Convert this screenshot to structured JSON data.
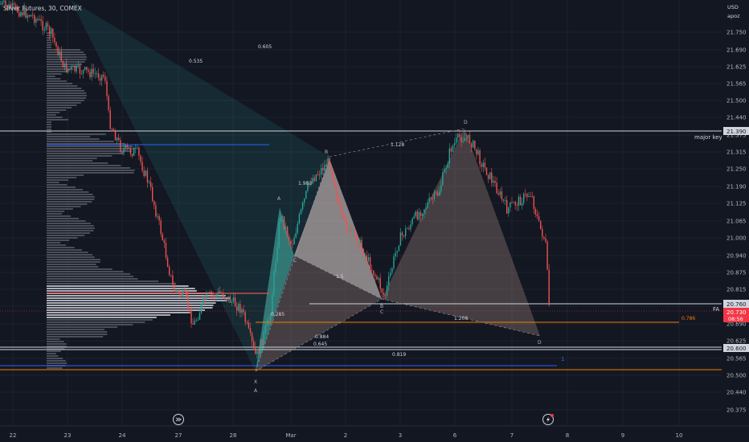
{
  "header": {
    "symbol": "Silver Futures, 30, COMEX"
  },
  "price_axis": {
    "currency": "USD",
    "author": "apoz",
    "ticks": [
      "21.750",
      "21.690",
      "21.625",
      "21.565",
      "21.500",
      "21.440",
      "21.375",
      "21.315",
      "21.250",
      "21.190",
      "21.125",
      "21.065",
      "21.000",
      "20.940",
      "20.875",
      "20.815",
      "20.750",
      "20.690",
      "20.625",
      "20.565",
      "20.500",
      "20.440",
      "20.375"
    ],
    "badges": {
      "key_level": "21.390",
      "level_760": "20.760",
      "last_price": "20.730",
      "countdown": "08:56",
      "level_600": "20.600"
    }
  },
  "time_axis": {
    "ticks": [
      "22",
      "23",
      "24",
      "27",
      "28",
      "Mar",
      "2",
      "3",
      "6",
      "7",
      "8",
      "9",
      "10"
    ]
  },
  "annotations": {
    "major_key": "major key",
    "fa": "FA",
    "fib_values": [
      "0.535",
      "0.605",
      "0.285",
      "0.884",
      "0.645",
      "0.819",
      "1.208",
      "0.786",
      "1.5",
      "1.128",
      "1.983"
    ],
    "points": [
      "X",
      "A",
      "B",
      "C",
      "D",
      "A",
      "B",
      "C",
      "D"
    ],
    "right_marker": "1"
  },
  "colors": {
    "background": "#131722",
    "up": "#26a69a",
    "down": "#ef5350",
    "orange_line": "#f57c00",
    "blue_line": "#2962ff",
    "last_price_badge": "#f23645"
  }
}
